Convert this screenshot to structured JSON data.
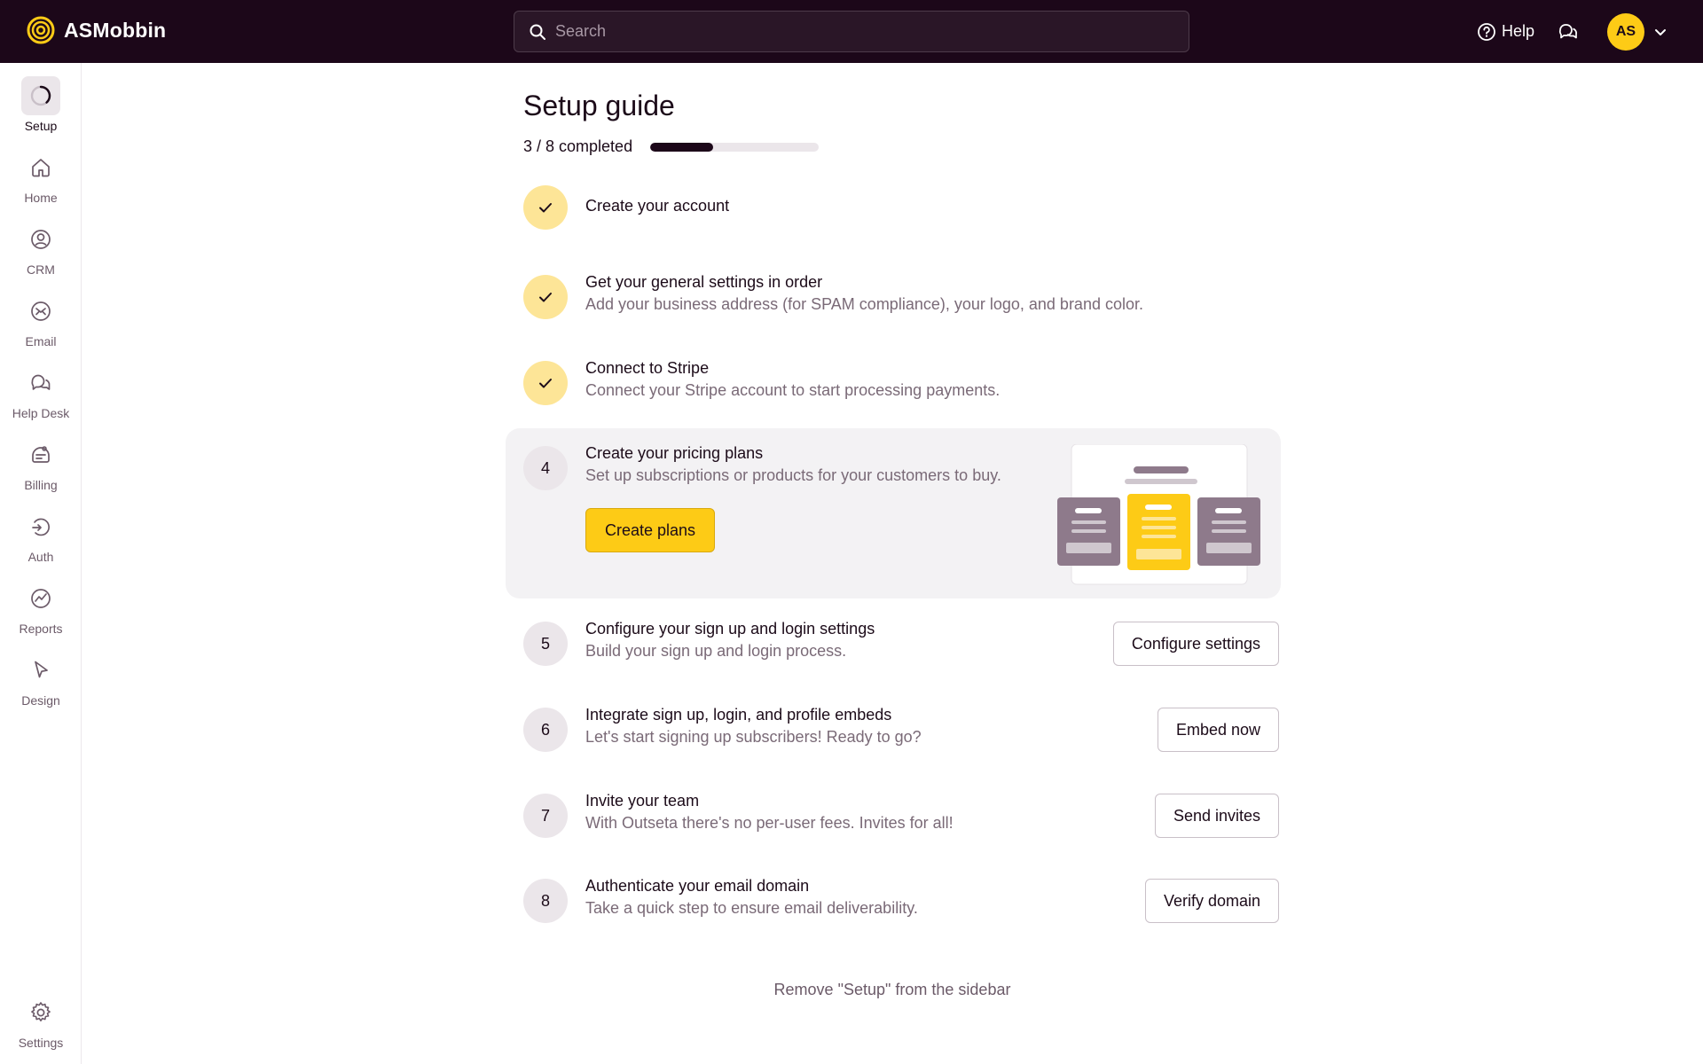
{
  "app": {
    "brand_name": "ASMobbin",
    "accent_color": "#fdcb16",
    "topbar_color": "#1c0719"
  },
  "header": {
    "search_placeholder": "Search",
    "help_label": "Help",
    "avatar_initials": "AS",
    "icons": [
      "search-icon",
      "help-circle-icon",
      "chat-icon",
      "chevron-down-icon"
    ]
  },
  "sidebar": {
    "items": [
      {
        "label": "Setup",
        "icon": "progress-ring-icon",
        "active": true
      },
      {
        "label": "Home",
        "icon": "home-icon"
      },
      {
        "label": "CRM",
        "icon": "person-circle-icon"
      },
      {
        "label": "Email",
        "icon": "email-icon"
      },
      {
        "label": "Help Desk",
        "icon": "chat-bubbles-icon"
      },
      {
        "label": "Billing",
        "icon": "billing-icon"
      },
      {
        "label": "Auth",
        "icon": "auth-icon"
      },
      {
        "label": "Reports",
        "icon": "reports-icon"
      },
      {
        "label": "Design",
        "icon": "pointer-icon"
      }
    ],
    "footer": {
      "label": "Settings",
      "icon": "gear-icon"
    }
  },
  "main": {
    "title": "Setup guide",
    "progress_text": "3 / 8 completed",
    "progress_fraction": 0.375,
    "steps": [
      {
        "number": "1",
        "status": "done",
        "title": "Create your account",
        "description": ""
      },
      {
        "number": "2",
        "status": "done",
        "title": "Get your general settings in order",
        "description": "Add your business address (for SPAM compliance), your logo, and brand color."
      },
      {
        "number": "3",
        "status": "done",
        "title": "Connect to Stripe",
        "description": "Connect your Stripe account to start processing payments."
      },
      {
        "number": "4",
        "status": "active",
        "title": "Create your pricing plans",
        "description": "Set up subscriptions or products for your customers to buy.",
        "button": "Create plans"
      },
      {
        "number": "5",
        "status": "todo",
        "title": "Configure your sign up and login settings",
        "description": "Build your sign up and login process.",
        "button": "Configure settings"
      },
      {
        "number": "6",
        "status": "todo",
        "title": "Integrate sign up, login, and profile embeds",
        "description": "Let's start signing up subscribers! Ready to go?",
        "button": "Embed now"
      },
      {
        "number": "7",
        "status": "todo",
        "title": "Invite your team",
        "description": "With Outseta there's no per-user fees. Invites for all!",
        "button": "Send invites"
      },
      {
        "number": "8",
        "status": "todo",
        "title": "Authenticate your email domain",
        "description": "Take a quick step to ensure email deliverability.",
        "button": "Verify domain"
      }
    ],
    "remove_link": "Remove \"Setup\" from the sidebar"
  }
}
